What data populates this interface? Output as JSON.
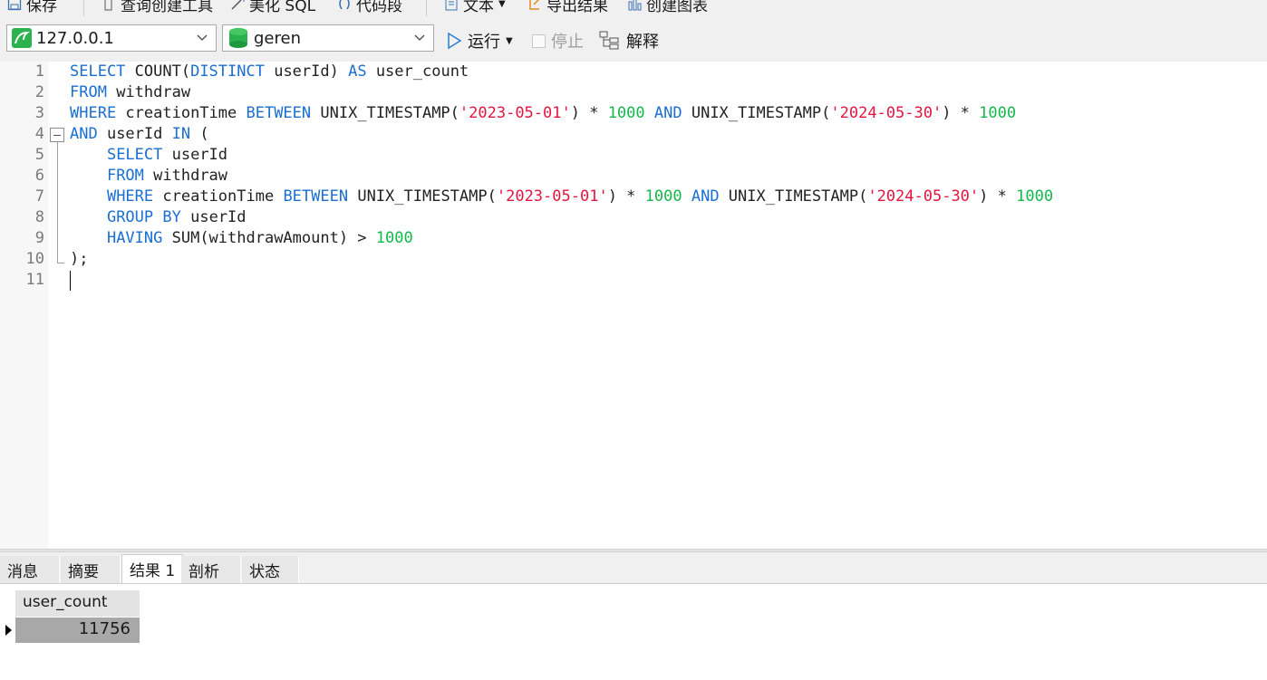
{
  "toolbar": {
    "save_label": "保存",
    "query_builder_label": "查询创建工具",
    "beautify_label": "美化 SQL",
    "snippet_label": "代码段",
    "text_label": "文本",
    "export_label": "导出结果",
    "chart_label": "创建图表"
  },
  "connection": {
    "value": "127.0.0.1",
    "accent": "#2bb24c"
  },
  "database": {
    "value": "geren",
    "accent": "#2bb24c"
  },
  "actions": {
    "run_label": "运行",
    "stop_label": "停止",
    "explain_label": "解释"
  },
  "editor": {
    "line_numbers": [
      "1",
      "2",
      "3",
      "4",
      "5",
      "6",
      "7",
      "8",
      "9",
      "10",
      "11"
    ],
    "lines": [
      [
        {
          "t": "SELECT",
          "c": "kw"
        },
        {
          "t": " COUNT(",
          "c": ""
        },
        {
          "t": "DISTINCT",
          "c": "kw"
        },
        {
          "t": " userId) ",
          "c": ""
        },
        {
          "t": "AS",
          "c": "kw"
        },
        {
          "t": " user_count",
          "c": ""
        }
      ],
      [
        {
          "t": "FROM",
          "c": "kw"
        },
        {
          "t": " withdraw",
          "c": ""
        }
      ],
      [
        {
          "t": "WHERE",
          "c": "kw"
        },
        {
          "t": " creationTime ",
          "c": ""
        },
        {
          "t": "BETWEEN",
          "c": "kw"
        },
        {
          "t": " UNIX_TIMESTAMP(",
          "c": ""
        },
        {
          "t": "'2023-05-01'",
          "c": "str"
        },
        {
          "t": ") * ",
          "c": ""
        },
        {
          "t": "1000",
          "c": "num"
        },
        {
          "t": " ",
          "c": ""
        },
        {
          "t": "AND",
          "c": "kw"
        },
        {
          "t": " UNIX_TIMESTAMP(",
          "c": ""
        },
        {
          "t": "'2024-05-30'",
          "c": "str"
        },
        {
          "t": ") * ",
          "c": ""
        },
        {
          "t": "1000",
          "c": "num"
        }
      ],
      [
        {
          "t": "AND",
          "c": "kw"
        },
        {
          "t": " userId ",
          "c": ""
        },
        {
          "t": "IN",
          "c": "kw"
        },
        {
          "t": " (",
          "c": ""
        }
      ],
      [
        {
          "t": "    ",
          "c": ""
        },
        {
          "t": "SELECT",
          "c": "kw"
        },
        {
          "t": " userId",
          "c": ""
        }
      ],
      [
        {
          "t": "    ",
          "c": ""
        },
        {
          "t": "FROM",
          "c": "kw"
        },
        {
          "t": " withdraw",
          "c": ""
        }
      ],
      [
        {
          "t": "    ",
          "c": ""
        },
        {
          "t": "WHERE",
          "c": "kw"
        },
        {
          "t": " creationTime ",
          "c": ""
        },
        {
          "t": "BETWEEN",
          "c": "kw"
        },
        {
          "t": " UNIX_TIMESTAMP(",
          "c": ""
        },
        {
          "t": "'2023-05-01'",
          "c": "str"
        },
        {
          "t": ") * ",
          "c": ""
        },
        {
          "t": "1000",
          "c": "num"
        },
        {
          "t": " ",
          "c": ""
        },
        {
          "t": "AND",
          "c": "kw"
        },
        {
          "t": " UNIX_TIMESTAMP(",
          "c": ""
        },
        {
          "t": "'2024-05-30'",
          "c": "str"
        },
        {
          "t": ") * ",
          "c": ""
        },
        {
          "t": "1000",
          "c": "num"
        }
      ],
      [
        {
          "t": "    ",
          "c": ""
        },
        {
          "t": "GROUP",
          "c": "kw"
        },
        {
          "t": " ",
          "c": ""
        },
        {
          "t": "BY",
          "c": "kw"
        },
        {
          "t": " userId",
          "c": ""
        }
      ],
      [
        {
          "t": "    ",
          "c": ""
        },
        {
          "t": "HAVING",
          "c": "kw"
        },
        {
          "t": " SUM(withdrawAmount) > ",
          "c": ""
        },
        {
          "t": "1000",
          "c": "num"
        }
      ],
      [
        {
          "t": ");",
          "c": ""
        }
      ],
      [
        {
          "t": "",
          "c": ""
        }
      ]
    ]
  },
  "result_tabs": [
    "消息",
    "摘要",
    "结果 1",
    "剖析",
    "状态"
  ],
  "result_grid": {
    "columns": [
      "user_count"
    ],
    "rows": [
      [
        "11756"
      ]
    ]
  }
}
